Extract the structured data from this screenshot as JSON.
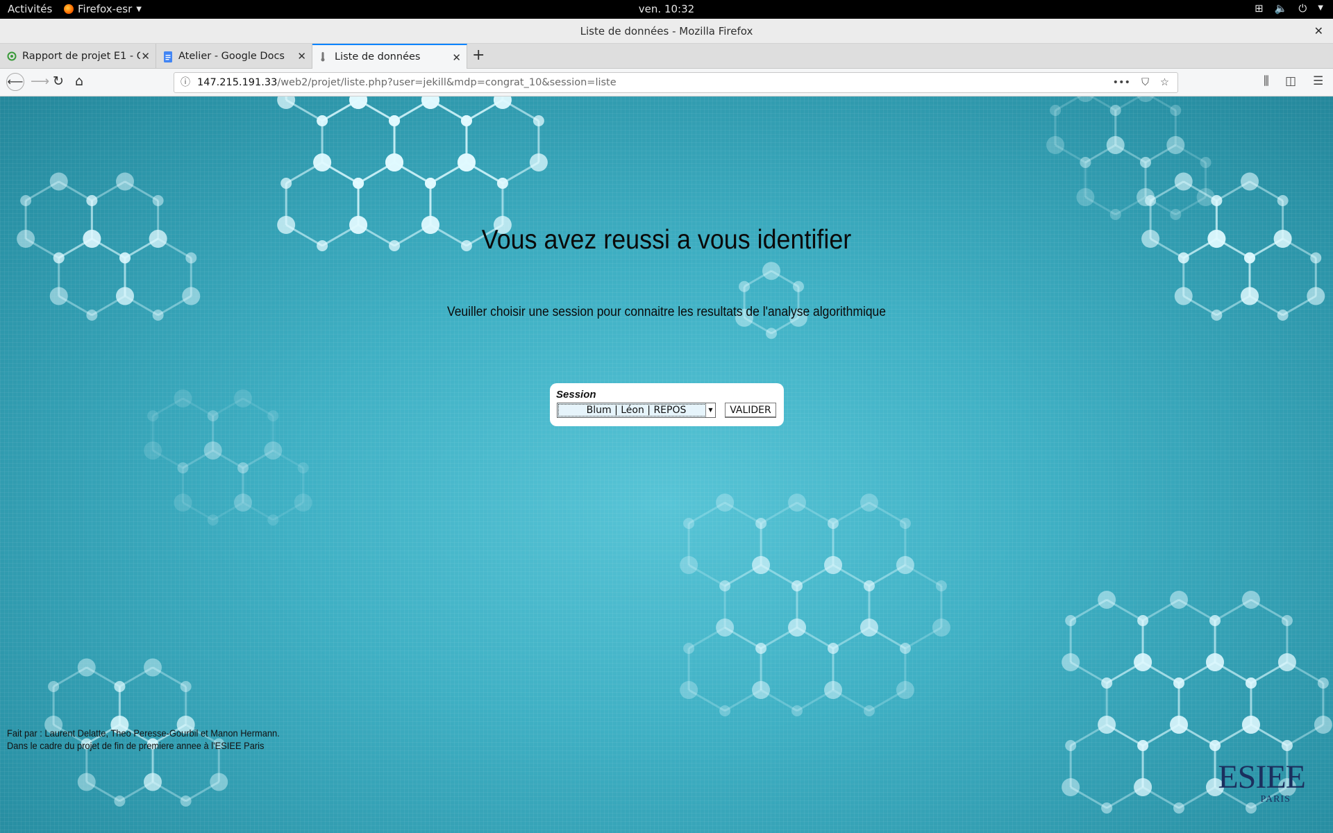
{
  "topbar": {
    "activities": "Activités",
    "app_name": "Firefox-esr",
    "clock": "ven. 10:32"
  },
  "window": {
    "title": "Liste de données - Mozilla Firefox"
  },
  "tabs": [
    {
      "label": "Rapport de projet E1 - On",
      "active": false
    },
    {
      "label": "Atelier - Google Docs",
      "active": false
    },
    {
      "label": "Liste de données",
      "active": true
    }
  ],
  "urlbar": {
    "host": "147.215.191.33",
    "path": "/web2/projet/liste.php?user=jekill&mdp=congrat_10&session=liste"
  },
  "page": {
    "headline": "Vous avez reussi a vous identifier",
    "subline": "Veuiller choisir une session pour connaitre les resultats de l'analyse algorithmique",
    "session_label": "Session",
    "session_selected": "Blum | Léon | REPOS",
    "submit_label": "VALIDER",
    "footer_line1": "Fait par : Laurent Delatte, Theo Peresse-Gourbil et Manon Hermann.",
    "footer_line2": "Dans le cadre du projet de fin de premiere annee à l'ESIEE Paris",
    "logo_main": "ESIEE",
    "logo_sub": "PARIS"
  },
  "colors": {
    "accent_tab": "#0a84ff",
    "page_bg": "#46b6c9",
    "logo": "#1b2f5e"
  }
}
